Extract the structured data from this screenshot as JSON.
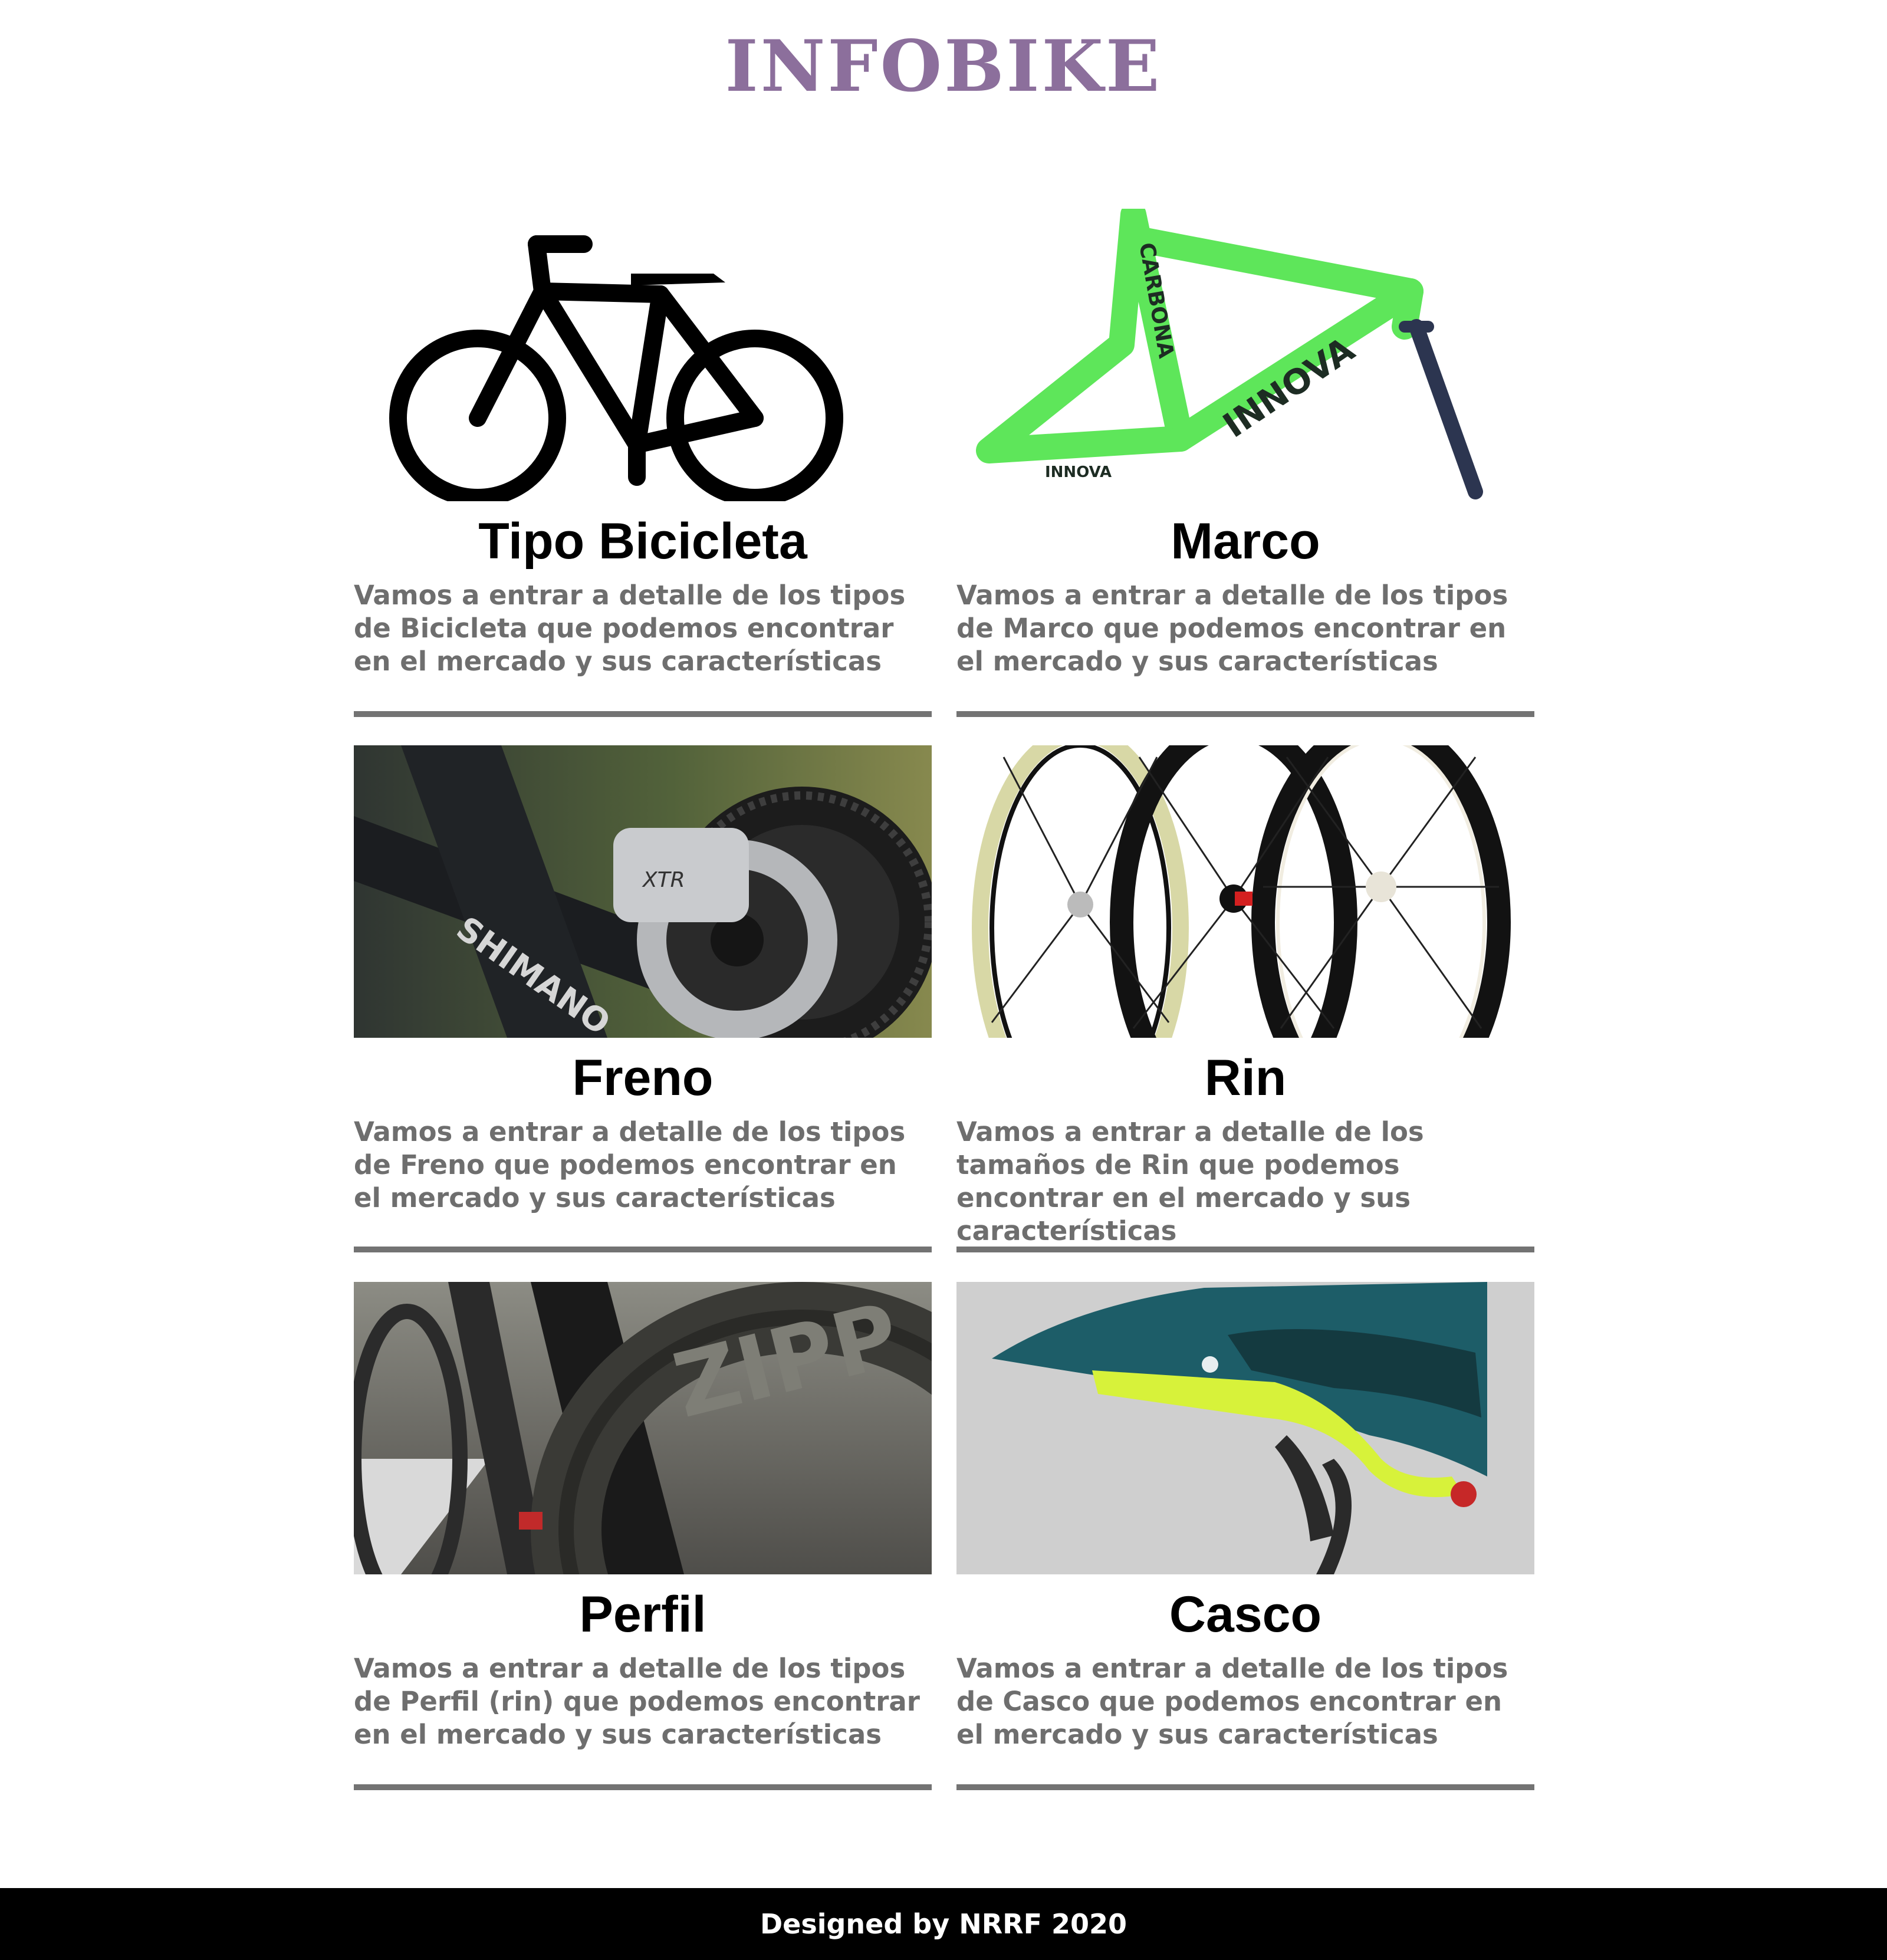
{
  "site": {
    "title": "INFOBIKE"
  },
  "cards": [
    {
      "title": "Tipo Bicicleta",
      "description": "Vamos a entrar a detalle de los tipos de Bicicleta que podemos encontrar en el mercado y sus características",
      "image": "bicycle-icon"
    },
    {
      "title": "Marco",
      "description": "Vamos a entrar a detalle de los tipos de Marco que podemos encontrar en el mercado y sus características",
      "image": "bike-frame-photo"
    },
    {
      "title": "Freno",
      "description": "Vamos a entrar a detalle de los tipos de Freno que podemos encontrar en el mercado y sus características",
      "image": "disc-brake-photo"
    },
    {
      "title": "Rin",
      "description": "Vamos a entrar a detalle de los tamaños de Rin que podemos encontrar en el mercado y sus características",
      "image": "wheels-photo"
    },
    {
      "title": "Perfil",
      "description": "Vamos a entrar a detalle de los tipos de Perfil (rin) que podemos encontrar en el mercado y sus características",
      "image": "rim-profile-photo"
    },
    {
      "title": "Casco",
      "description": "Vamos a entrar a detalle de los tipos de Casco que podemos encontrar en el mercado y sus características",
      "image": "helmet-photo"
    }
  ],
  "footer": {
    "text": "Designed by NRRF 2020"
  }
}
